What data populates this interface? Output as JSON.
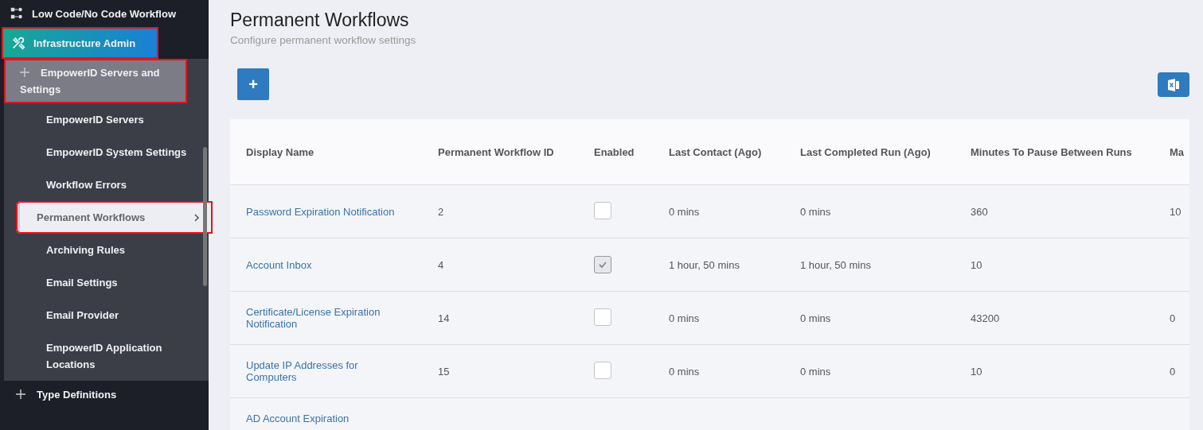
{
  "sidebar": {
    "items": [
      {
        "label": "Low Code/No Code Workflow",
        "kind": "section",
        "selected": false,
        "highlighted": false
      },
      {
        "label": "Infrastructure Admin",
        "kind": "section",
        "selected": true,
        "highlighted": true
      },
      {
        "label": "EmpowerID Servers and Settings",
        "kind": "group",
        "expanded": true,
        "highlighted": true,
        "children": [
          {
            "label": "EmpowerID Servers",
            "selected": false,
            "highlighted": false
          },
          {
            "label": "EmpowerID System Settings",
            "selected": false,
            "highlighted": false
          },
          {
            "label": "Workflow Errors",
            "selected": false,
            "highlighted": false
          },
          {
            "label": "Permanent Workflows",
            "selected": true,
            "highlighted": true
          },
          {
            "label": "Archiving Rules",
            "selected": false,
            "highlighted": false
          },
          {
            "label": "Email Settings",
            "selected": false,
            "highlighted": false
          },
          {
            "label": "Email Provider",
            "selected": false,
            "highlighted": false
          },
          {
            "label": "EmpowerID Application Locations",
            "selected": false,
            "highlighted": false
          }
        ]
      },
      {
        "label": "Type Definitions",
        "kind": "group",
        "expanded": false,
        "highlighted": false
      }
    ]
  },
  "page": {
    "title": "Permanent Workflows",
    "subtitle": "Configure permanent workflow settings",
    "add_button": "+"
  },
  "table": {
    "columns": [
      "Display Name",
      "Permanent Workflow ID",
      "Enabled",
      "Last Contact (Ago)",
      "Last Completed Run (Ago)",
      "Minutes To Pause Between Runs",
      "Ma"
    ],
    "rows": [
      {
        "display_name": "Password Expiration Notification",
        "id": "2",
        "enabled": false,
        "last_contact": "0 mins",
        "last_completed": "0 mins",
        "pause": "360",
        "column_7": "10"
      },
      {
        "display_name": "Account Inbox",
        "id": "4",
        "enabled": true,
        "last_contact": "1 hour, 50 mins",
        "last_completed": "1 hour, 50 mins",
        "pause": "10"
      },
      {
        "display_name": "Certificate/License Expiration Notification",
        "id": "14",
        "enabled": false,
        "last_contact": "0 mins",
        "last_completed": "0 mins",
        "pause": "43200",
        "column_7": "0"
      },
      {
        "display_name": "Update IP Addresses for Computers",
        "id": "15",
        "enabled": false,
        "last_contact": "0 mins",
        "last_completed": "0 mins",
        "pause": "10",
        "column_7": "0"
      },
      {
        "display_name": "AD Account Expiration"
      }
    ]
  }
}
